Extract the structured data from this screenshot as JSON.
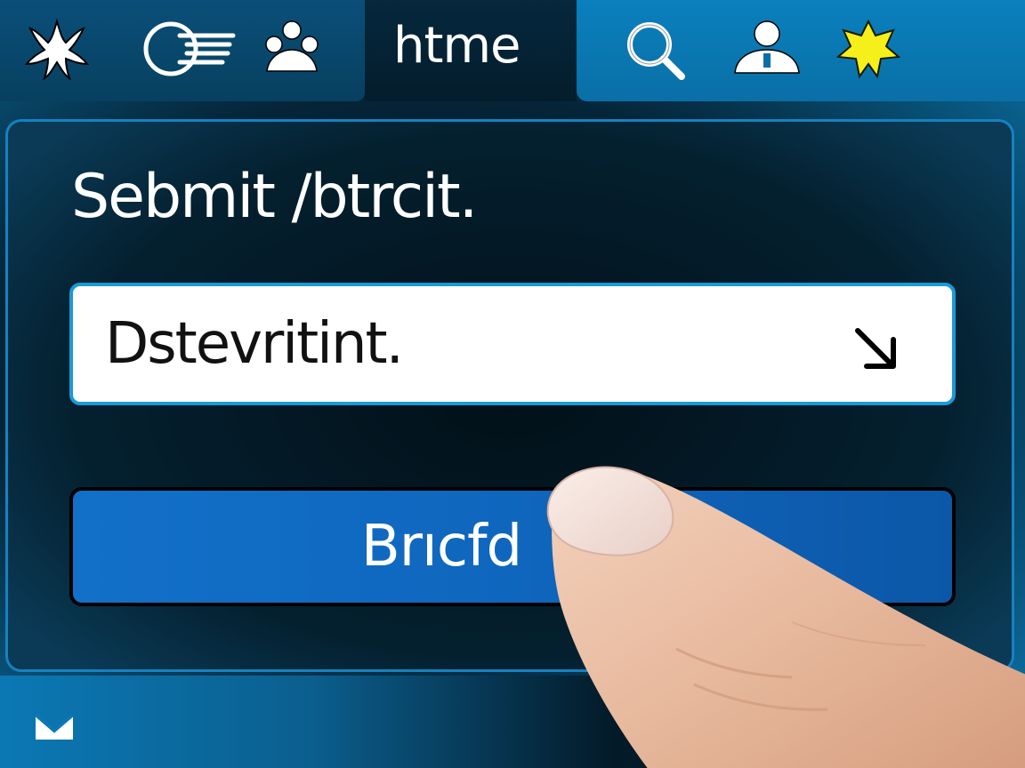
{
  "topbar": {
    "icons": [
      "starfish-icon",
      "motion-circle-icon",
      "paw-icon",
      "search-icon",
      "user-icon",
      "star-icon"
    ],
    "active_tab_label": "htme"
  },
  "panel": {
    "title": "Sebmit /btrcit.",
    "field": {
      "value": "Dstevritint.",
      "icon": "arrow-down-right-icon"
    },
    "button": {
      "label": "Brıcfd"
    }
  },
  "bottom": {
    "icon": "mail-icon"
  },
  "colors": {
    "accent": "#1a9ad8",
    "button": "#0f66bd",
    "star": "#f5ef1a"
  }
}
